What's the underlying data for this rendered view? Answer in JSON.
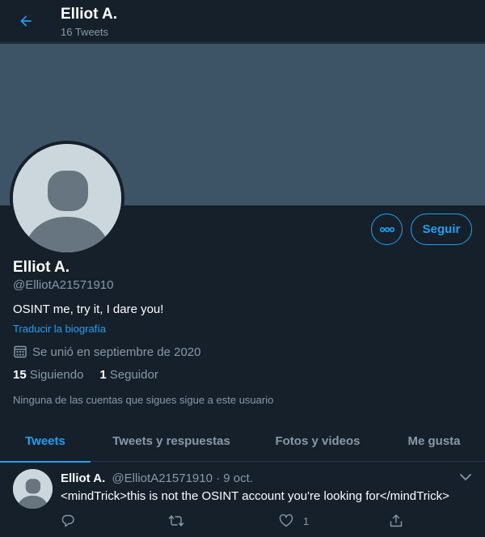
{
  "header": {
    "name": "Elliot A.",
    "tweet_count": "16 Tweets",
    "back_icon": "arrow-left-icon"
  },
  "colors": {
    "background": "#15202b",
    "accent": "#1da1f2",
    "banner": "#3d5466",
    "muted_text": "#8899a6",
    "avatar_placeholder": "#ccd6dd"
  },
  "profile": {
    "name": "Elliot A.",
    "handle": "@ElliotA21571910",
    "bio": "OSINT me, try it, I dare you!",
    "translate_label": "Traducir la biografía",
    "joined": "Se unió en septiembre de 2020",
    "joined_icon": "calendar-icon",
    "following_count": "15",
    "following_label": "Siguiendo",
    "followers_count": "1",
    "followers_label": "Seguidor",
    "followed_by_note": "Ninguna de las cuentas que sigues sigue a este usuario"
  },
  "actions": {
    "more_icon": "more-horizontal-icon",
    "follow_label": "Seguir"
  },
  "tabs": [
    {
      "label": "Tweets",
      "active": true
    },
    {
      "label": "Tweets y respuestas",
      "active": false
    },
    {
      "label": "Fotos y videos",
      "active": false
    },
    {
      "label": "Me gusta",
      "active": false
    }
  ],
  "tweet": {
    "author_name": "Elliot A.",
    "author_handle": "@ElliotA21571910",
    "separator": "·",
    "date": "9 oct.",
    "text": "<mindTrick>this is not the OSINT account you're looking for</mindTrick>",
    "reply_count": "",
    "retweet_count": "",
    "like_count": "1",
    "icons": [
      "reply-icon",
      "retweet-icon",
      "like-icon",
      "share-icon",
      "chevron-down-icon"
    ]
  }
}
